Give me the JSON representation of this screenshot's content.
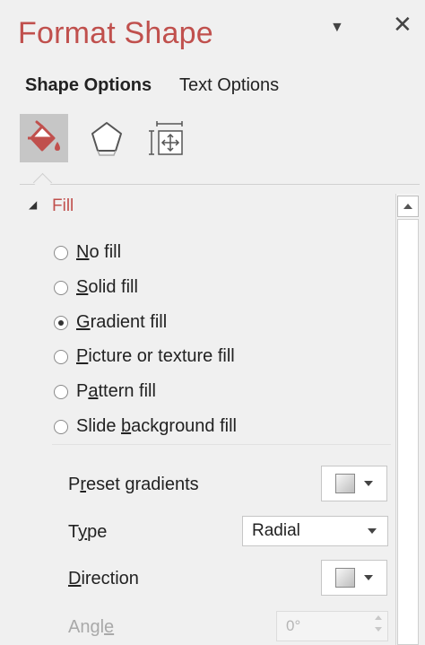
{
  "pane": {
    "title": "Format Shape",
    "menu_glyph": "▼",
    "close_glyph": "✕"
  },
  "tabs": [
    {
      "label": "Shape Options",
      "active": true
    },
    {
      "label": "Text Options",
      "active": false
    }
  ],
  "icon_tabs": [
    {
      "name": "fill-line-icon",
      "selected": true
    },
    {
      "name": "effects-icon",
      "selected": false
    },
    {
      "name": "size-properties-icon",
      "selected": false
    }
  ],
  "fill_section": {
    "caret": "◢",
    "title": "Fill",
    "options": [
      {
        "label": "No fill",
        "underline": "N",
        "checked": false
      },
      {
        "label": "Solid fill",
        "underline": "S",
        "checked": false
      },
      {
        "label": "Gradient fill",
        "underline": "G",
        "checked": true
      },
      {
        "label": "Picture or texture fill",
        "underline": "P",
        "checked": false
      },
      {
        "label": "Pattern fill",
        "underline": "a",
        "checked": false
      },
      {
        "label": "Slide background fill",
        "underline": "b",
        "checked": false
      }
    ]
  },
  "gradient_props": {
    "preset_label": "Preset gradients",
    "type_label": "Type",
    "type_value": "Radial",
    "direction_label": "Direction",
    "angle_label": "Angle",
    "angle_value": "0°"
  },
  "colors": {
    "accent": "#c0504d",
    "selected_icon_bg": "#c6c6c6"
  }
}
